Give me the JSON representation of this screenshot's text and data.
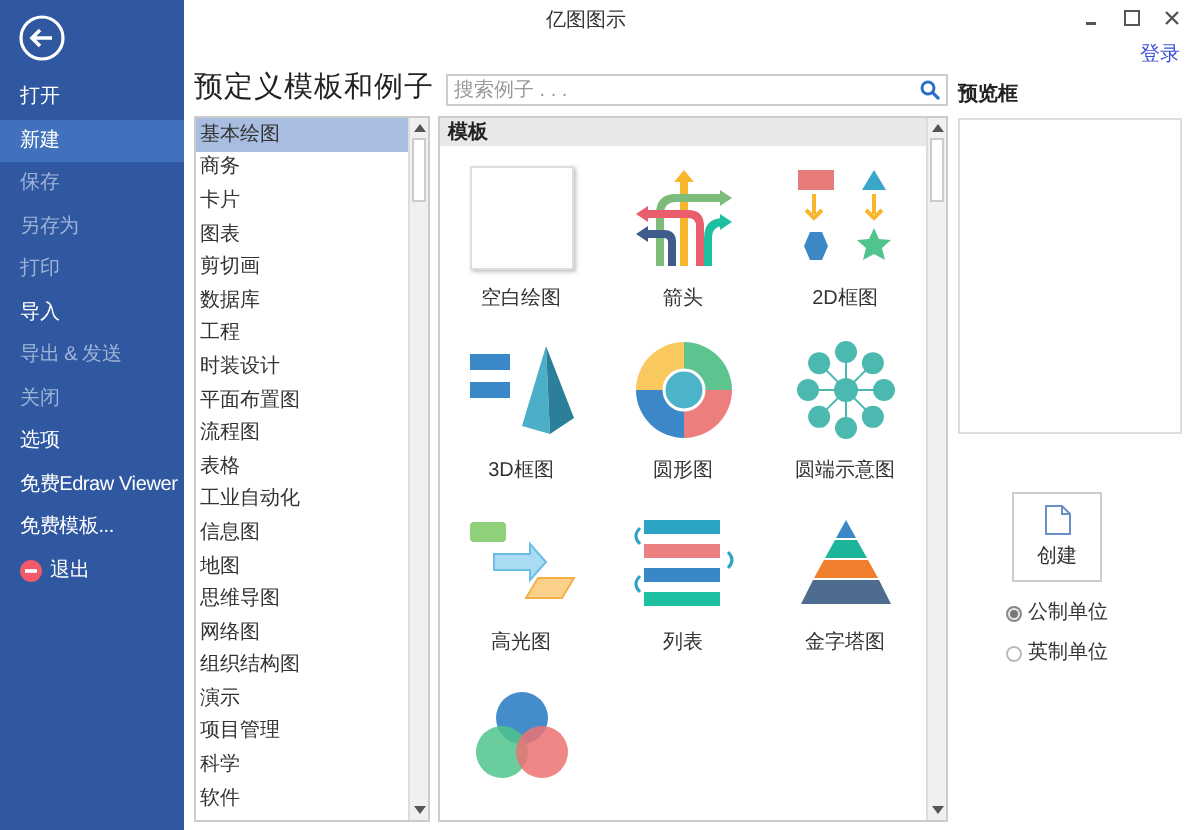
{
  "window": {
    "title": "亿图图示",
    "login_link": "登录"
  },
  "sidebar": {
    "items": [
      {
        "label": "打开",
        "selected": false,
        "disabled": false,
        "kind": "plain"
      },
      {
        "label": "新建",
        "selected": true,
        "disabled": false,
        "kind": "plain"
      },
      {
        "label": "保存",
        "selected": false,
        "disabled": true,
        "kind": "plain"
      },
      {
        "label": "另存为",
        "selected": false,
        "disabled": true,
        "kind": "plain"
      },
      {
        "label": "打印",
        "selected": false,
        "disabled": true,
        "kind": "plain"
      },
      {
        "label": "导入",
        "selected": false,
        "disabled": false,
        "kind": "plain"
      },
      {
        "label": "导出 & 发送",
        "selected": false,
        "disabled": true,
        "kind": "plain"
      },
      {
        "label": "关闭",
        "selected": false,
        "disabled": true,
        "kind": "plain"
      },
      {
        "label": "选项",
        "selected": false,
        "disabled": false,
        "kind": "plain"
      },
      {
        "label": "免费Edraw Viewer",
        "selected": false,
        "disabled": false,
        "kind": "plain"
      },
      {
        "label": "免费模板...",
        "selected": false,
        "disabled": false,
        "kind": "plain"
      },
      {
        "label": "退出",
        "selected": false,
        "disabled": false,
        "kind": "exit"
      }
    ]
  },
  "heading": "预定义模板和例子",
  "search": {
    "placeholder": "搜索例子 . . ."
  },
  "categories": [
    {
      "label": "基本绘图",
      "selected": true
    },
    {
      "label": "商务",
      "selected": false
    },
    {
      "label": "卡片",
      "selected": false
    },
    {
      "label": "图表",
      "selected": false
    },
    {
      "label": "剪切画",
      "selected": false
    },
    {
      "label": "数据库",
      "selected": false
    },
    {
      "label": "工程",
      "selected": false
    },
    {
      "label": "时装设计",
      "selected": false
    },
    {
      "label": "平面布置图",
      "selected": false
    },
    {
      "label": "流程图",
      "selected": false
    },
    {
      "label": "表格",
      "selected": false
    },
    {
      "label": "工业自动化",
      "selected": false
    },
    {
      "label": "信息图",
      "selected": false
    },
    {
      "label": "地图",
      "selected": false
    },
    {
      "label": "思维导图",
      "selected": false
    },
    {
      "label": "网络图",
      "selected": false
    },
    {
      "label": "组织结构图",
      "selected": false
    },
    {
      "label": "演示",
      "selected": false
    },
    {
      "label": "项目管理",
      "selected": false
    },
    {
      "label": "科学",
      "selected": false
    },
    {
      "label": "软件",
      "selected": false
    }
  ],
  "templates": {
    "header": "模板",
    "items": [
      {
        "label": "空白绘图",
        "kind": "blank"
      },
      {
        "label": "箭头",
        "kind": "arrows"
      },
      {
        "label": "2D框图",
        "kind": "block2d"
      },
      {
        "label": "3D框图",
        "kind": "block3d"
      },
      {
        "label": "圆形图",
        "kind": "ring"
      },
      {
        "label": "圆端示意图",
        "kind": "cluster"
      },
      {
        "label": "高光图",
        "kind": "highlight"
      },
      {
        "label": "列表",
        "kind": "list"
      },
      {
        "label": "金字塔图",
        "kind": "pyramid"
      },
      {
        "kind": "venn"
      }
    ]
  },
  "preview": {
    "label": "预览框"
  },
  "create_button": "创建",
  "units": [
    {
      "label": "公制单位",
      "selected": true
    },
    {
      "label": "英制单位",
      "selected": false
    }
  ]
}
